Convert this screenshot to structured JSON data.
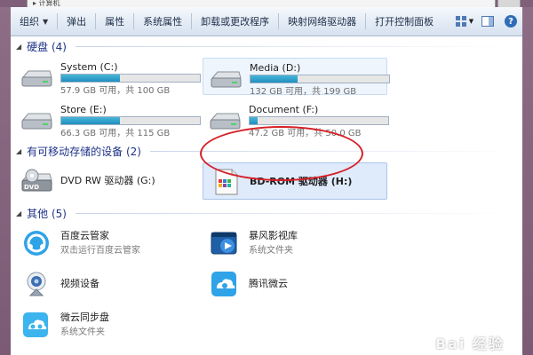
{
  "window": {
    "address_path": "▸ 计算机"
  },
  "toolbar": {
    "items": [
      {
        "label": "组织",
        "has_dropdown": true
      },
      {
        "label": "弹出"
      },
      {
        "label": "属性"
      },
      {
        "label": "系统属性"
      },
      {
        "label": "卸载或更改程序"
      },
      {
        "label": "映射网络驱动器"
      },
      {
        "label": "打开控制面板"
      }
    ],
    "help_glyph": "?"
  },
  "groups": {
    "hard_disks": {
      "label": "硬盘 (4)"
    },
    "removable": {
      "label": "有可移动存储的设备 (2)"
    },
    "other": {
      "label": "其他 (5)"
    }
  },
  "drives": [
    {
      "name": "System (C:)",
      "info": "57.9 GB 可用，共 100 GB",
      "used_fraction": 0.42
    },
    {
      "name": "Media (D:)",
      "info": "132 GB 可用，共 199 GB",
      "used_fraction": 0.34
    },
    {
      "name": "Store (E:)",
      "info": "66.3 GB 可用，共 115 GB",
      "used_fraction": 0.42
    },
    {
      "name": "Document (F:)",
      "info": "47.2 GB 可用，共 50.0 GB",
      "used_fraction": 0.06
    }
  ],
  "removable_devices": [
    {
      "name": "DVD RW 驱动器 (G:)",
      "icon": "dvd-drive-icon",
      "badge": "DVD"
    },
    {
      "name": "BD-ROM 驱动器 (H:)",
      "icon": "bd-rom-icon"
    }
  ],
  "others": [
    {
      "name": "百度云管家",
      "sub": "双击运行百度云管家",
      "icon": "baidu-cloud-icon"
    },
    {
      "name": "暴风影视库",
      "sub": "系统文件夹",
      "icon": "baofeng-video-icon"
    },
    {
      "name": "视频设备",
      "sub": "",
      "icon": "webcam-icon"
    },
    {
      "name": "腾讯微云",
      "sub": "",
      "icon": "tencent-weiyun-icon"
    },
    {
      "name": "微云同步盘",
      "sub": "系统文件夹",
      "icon": "weiyun-sync-icon"
    }
  ],
  "colors": {
    "accent_bar": "#1f8fbf",
    "group_header": "#1e3287",
    "annotation_oval": "#d61f26",
    "baidu_blue": "#2fa3e8"
  },
  "watermark": "Bai 经验"
}
